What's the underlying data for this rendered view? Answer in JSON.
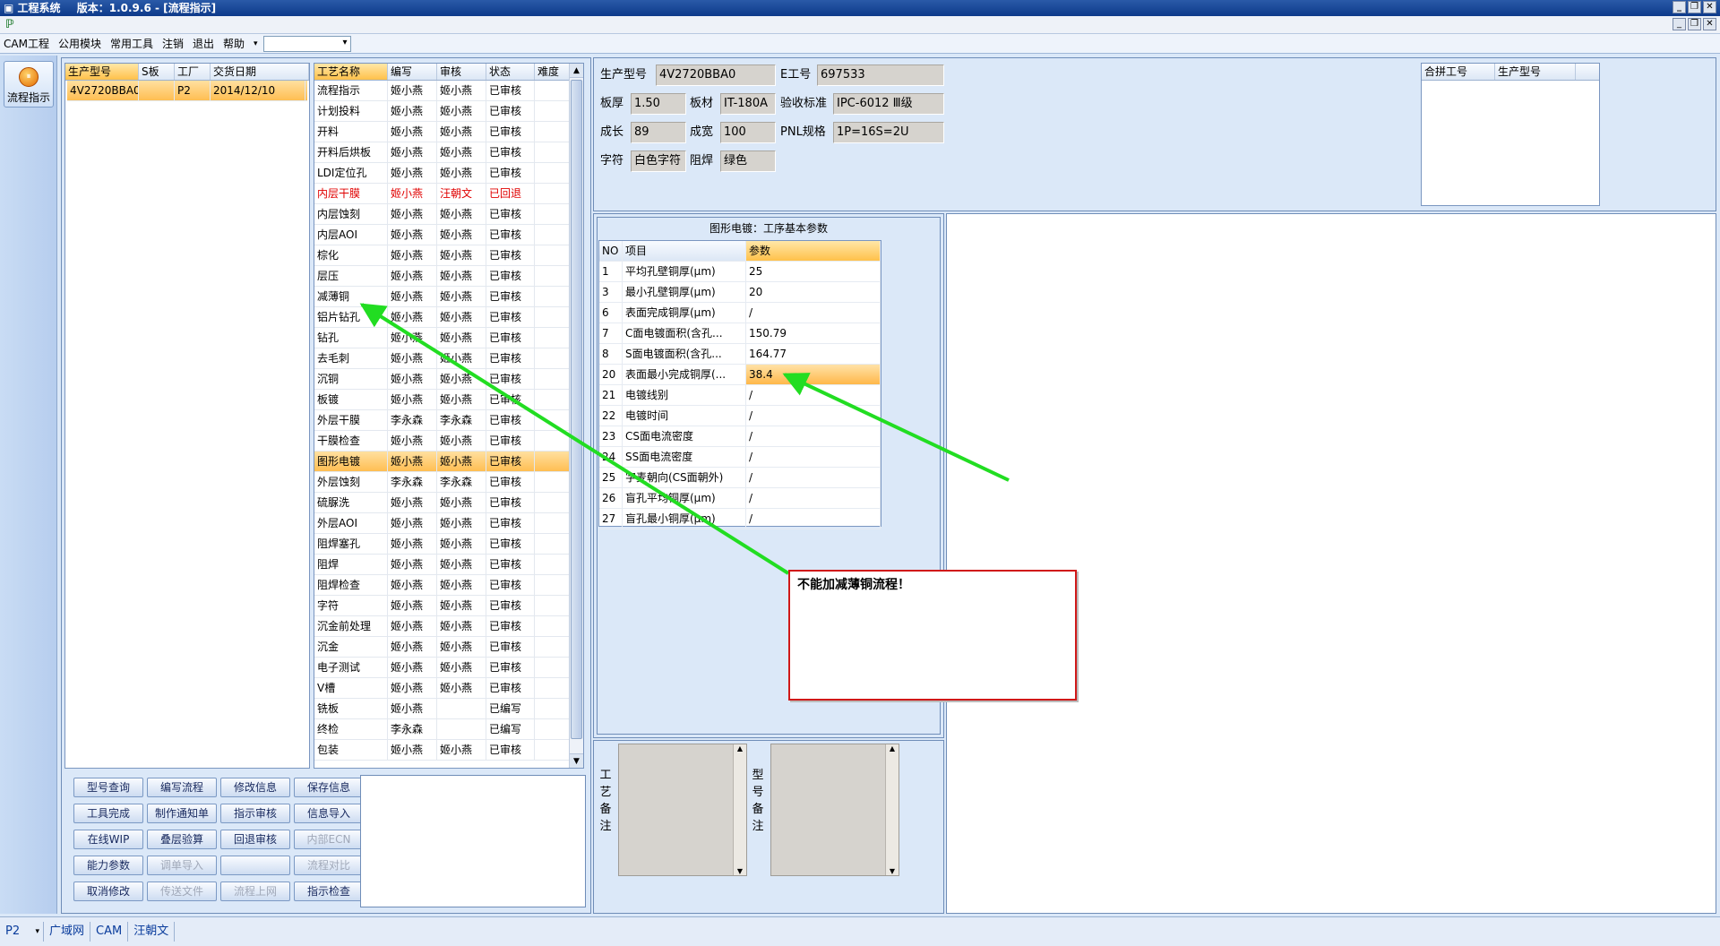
{
  "window": {
    "app_name": "工程系统",
    "version_title": "版本：1.0.9.6 - [流程指示]"
  },
  "menu": [
    "CAM工程",
    "公用模块",
    "常用工具",
    "注销",
    "退出",
    "帮助"
  ],
  "left_bar": {
    "flow_button": "流程指示"
  },
  "orders_grid": {
    "columns": [
      "生产型号",
      "S板",
      "工厂",
      "交货日期"
    ],
    "rows": [
      [
        "4V2720BBA0",
        "",
        "P2",
        "2014/12/10"
      ]
    ]
  },
  "process_grid": {
    "columns": [
      "工艺名称",
      "编写",
      "审核",
      "状态",
      "难度"
    ],
    "rows": [
      [
        "流程指示",
        "姬小燕",
        "姬小燕",
        "已审核",
        ""
      ],
      [
        "计划投料",
        "姬小燕",
        "姬小燕",
        "已审核",
        ""
      ],
      [
        "开料",
        "姬小燕",
        "姬小燕",
        "已审核",
        ""
      ],
      [
        "开料后烘板",
        "姬小燕",
        "姬小燕",
        "已审核",
        ""
      ],
      [
        "LDI定位孔",
        "姬小燕",
        "姬小燕",
        "已审核",
        ""
      ],
      [
        "内层干膜",
        "姬小燕",
        "汪朝文",
        "已回退",
        ""
      ],
      [
        "内层蚀刻",
        "姬小燕",
        "姬小燕",
        "已审核",
        ""
      ],
      [
        "内层AOI",
        "姬小燕",
        "姬小燕",
        "已审核",
        ""
      ],
      [
        "棕化",
        "姬小燕",
        "姬小燕",
        "已审核",
        ""
      ],
      [
        "层压",
        "姬小燕",
        "姬小燕",
        "已审核",
        ""
      ],
      [
        "减薄铜",
        "姬小燕",
        "姬小燕",
        "已审核",
        ""
      ],
      [
        "铝片钻孔",
        "姬小燕",
        "姬小燕",
        "已审核",
        ""
      ],
      [
        "钻孔",
        "姬小燕",
        "姬小燕",
        "已审核",
        ""
      ],
      [
        "去毛刺",
        "姬小燕",
        "姬小燕",
        "已审核",
        ""
      ],
      [
        "沉铜",
        "姬小燕",
        "姬小燕",
        "已审核",
        ""
      ],
      [
        "板镀",
        "姬小燕",
        "姬小燕",
        "已审核",
        ""
      ],
      [
        "外层干膜",
        "李永森",
        "李永森",
        "已审核",
        ""
      ],
      [
        "干膜检查",
        "姬小燕",
        "姬小燕",
        "已审核",
        ""
      ],
      [
        "图形电镀",
        "姬小燕",
        "姬小燕",
        "已审核",
        ""
      ],
      [
        "外层蚀刻",
        "李永森",
        "李永森",
        "已审核",
        ""
      ],
      [
        "硫脲洗",
        "姬小燕",
        "姬小燕",
        "已审核",
        ""
      ],
      [
        "外层AOI",
        "姬小燕",
        "姬小燕",
        "已审核",
        ""
      ],
      [
        "阻焊塞孔",
        "姬小燕",
        "姬小燕",
        "已审核",
        ""
      ],
      [
        "阻焊",
        "姬小燕",
        "姬小燕",
        "已审核",
        ""
      ],
      [
        "阻焊检查",
        "姬小燕",
        "姬小燕",
        "已审核",
        ""
      ],
      [
        "字符",
        "姬小燕",
        "姬小燕",
        "已审核",
        ""
      ],
      [
        "沉金前处理",
        "姬小燕",
        "姬小燕",
        "已审核",
        ""
      ],
      [
        "沉金",
        "姬小燕",
        "姬小燕",
        "已审核",
        ""
      ],
      [
        "电子测试",
        "姬小燕",
        "姬小燕",
        "已审核",
        ""
      ],
      [
        "V槽",
        "姬小燕",
        "姬小燕",
        "已审核",
        ""
      ],
      [
        "铣板",
        "姬小燕",
        "",
        "已编写",
        ""
      ],
      [
        "终检",
        "李永森",
        "",
        "已编写",
        ""
      ],
      [
        "包装",
        "姬小燕",
        "姬小燕",
        "已审核",
        ""
      ]
    ],
    "selected_index": 18,
    "rejected_index": 5
  },
  "buttons": [
    [
      "型号查询",
      "编写流程",
      "修改信息",
      "保存信息"
    ],
    [
      "工具完成",
      "制作通知单",
      "指示审核",
      "信息导入"
    ],
    [
      "在线WIP",
      "叠层验算",
      "回退审核",
      "内部ECN"
    ],
    [
      "能力参数",
      "调单导入",
      "",
      "流程对比"
    ],
    [
      "取消修改",
      "传送文件",
      "流程上网",
      "指示检查"
    ]
  ],
  "info": {
    "model_label": "生产型号",
    "model_value": "4V2720BBA0",
    "eng_label": "E工号",
    "eng_value": "697533",
    "thick_label": "板厚",
    "thick_value": "1.50",
    "material_label": "板材",
    "material_value": "IT-180A",
    "std_label": "验收标准",
    "std_value": "IPC-6012 Ⅲ级",
    "len_label": "成长",
    "len_value": "89",
    "wid_label": "成宽",
    "wid_value": "100",
    "pnl_label": "PNL规格",
    "pnl_value": "1P=16S=2U",
    "char_label": "字符",
    "char_value": "白色字符",
    "mask_label": "阻焊",
    "mask_value": "绿色"
  },
  "merge_grid": {
    "columns": [
      "合拼工号",
      "生产型号"
    ]
  },
  "params": {
    "title": "图形电镀：工序基本参数",
    "columns": [
      "NO",
      "项目",
      "参数"
    ],
    "rows": [
      [
        "1",
        "平均孔壁铜厚(μm)",
        "25"
      ],
      [
        "3",
        "最小孔壁铜厚(μm)",
        "20"
      ],
      [
        "6",
        "表面完成铜厚(μm)",
        "/"
      ],
      [
        "7",
        "C面电镀面积(含孔...",
        "150.79"
      ],
      [
        "8",
        "S面电镀面积(含孔...",
        "164.77"
      ],
      [
        "20",
        "表面最小完成铜厚(...",
        "38.4"
      ],
      [
        "21",
        "电镀线别",
        "/"
      ],
      [
        "22",
        "电镀时间",
        "/"
      ],
      [
        "23",
        "CS面电流密度",
        "/"
      ],
      [
        "24",
        "SS面电流密度",
        "/"
      ],
      [
        "25",
        "字麦朝向(CS面朝外)",
        "/"
      ],
      [
        "26",
        "盲孔平均铜厚(μm)",
        "/"
      ],
      [
        "27",
        "盲孔最小铜厚(μm)",
        "/"
      ]
    ],
    "selected_index": 5
  },
  "remarks": {
    "process": "工艺备注",
    "model": "型号备注"
  },
  "annotation": {
    "text": "不能加减薄铜流程！",
    "arrow_color": "#22dd22",
    "box_border": "#d01818"
  },
  "status_bar": {
    "plant": "P2",
    "network": "广域网",
    "dept": "CAM",
    "user": "汪朝文"
  }
}
